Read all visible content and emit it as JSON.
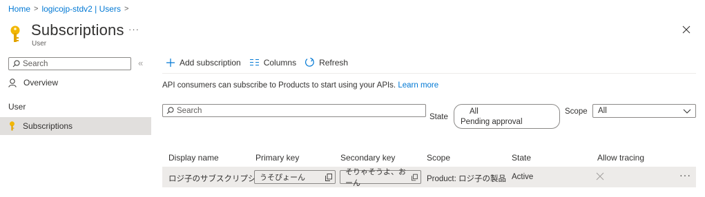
{
  "breadcrumb": {
    "home": "Home",
    "service": "logicojp-stdv2 | Users"
  },
  "header": {
    "title": "Subscriptions",
    "subtitle": "User",
    "more": "···"
  },
  "nav": {
    "search_placeholder": "Search",
    "collapse": "«",
    "overview": "Overview",
    "group": "User",
    "active_item": "Subscriptions"
  },
  "toolbar": {
    "add": "Add subscription",
    "columns": "Columns",
    "refresh": "Refresh"
  },
  "info": {
    "text": "API consumers can subscribe to Products to start using your APIs.",
    "link": "Learn more"
  },
  "filters": {
    "search_placeholder": "Search",
    "state_label": "State",
    "state_options": [
      "All",
      "Pending approval"
    ],
    "scope_label": "Scope",
    "scope_value": "All"
  },
  "table": {
    "headers": {
      "display_name": "Display name",
      "primary_key": "Primary key",
      "secondary_key": "Secondary key",
      "scope": "Scope",
      "state": "State",
      "allow_tracing": "Allow tracing"
    },
    "rows": [
      {
        "display_name": "ロジ子のサブスクリプション",
        "primary_key": "うそぴょーん",
        "secondary_key": "そりゃそうよ、おーん",
        "scope": "Product: ロジ子の製品",
        "state": "Active",
        "allow_tracing": false
      }
    ],
    "row_more": "···"
  },
  "colors": {
    "accent": "#0078d4",
    "key_icon": "#f2b705",
    "selected_bg": "#e1dfdd"
  }
}
